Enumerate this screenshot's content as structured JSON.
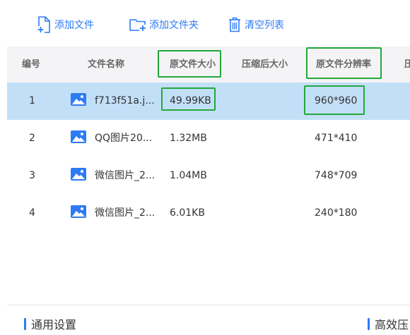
{
  "toolbar": {
    "add_file": "添加文件",
    "add_folder": "添加文件夹",
    "clear_list": "清空列表"
  },
  "table": {
    "headers": {
      "index": "编号",
      "name": "文件名称",
      "original_size": "原文件大小",
      "compressed_size": "压缩后大小",
      "original_resolution": "原文件分辨率",
      "next": "压"
    },
    "rows": [
      {
        "index": "1",
        "name": "f713f51a.j...",
        "original_size": "49.99KB",
        "compressed_size": "",
        "original_resolution": "960*960",
        "selected": true
      },
      {
        "index": "2",
        "name": "QQ图片20...",
        "original_size": "1.32MB",
        "compressed_size": "",
        "original_resolution": "471*410",
        "selected": false
      },
      {
        "index": "3",
        "name": "微信图片_2...",
        "original_size": "1.04MB",
        "compressed_size": "",
        "original_resolution": "748*709",
        "selected": false
      },
      {
        "index": "4",
        "name": "微信图片_2...",
        "original_size": "6.01KB",
        "compressed_size": "",
        "original_resolution": "240*180",
        "selected": false
      }
    ]
  },
  "sections": {
    "general_settings": "通用设置",
    "efficient": "高效压"
  },
  "colors": {
    "accent": "#2d7bf5",
    "selected_row": "#c2dff8",
    "highlight_box": "#22a83a",
    "header_bg": "#f4f4f6"
  }
}
